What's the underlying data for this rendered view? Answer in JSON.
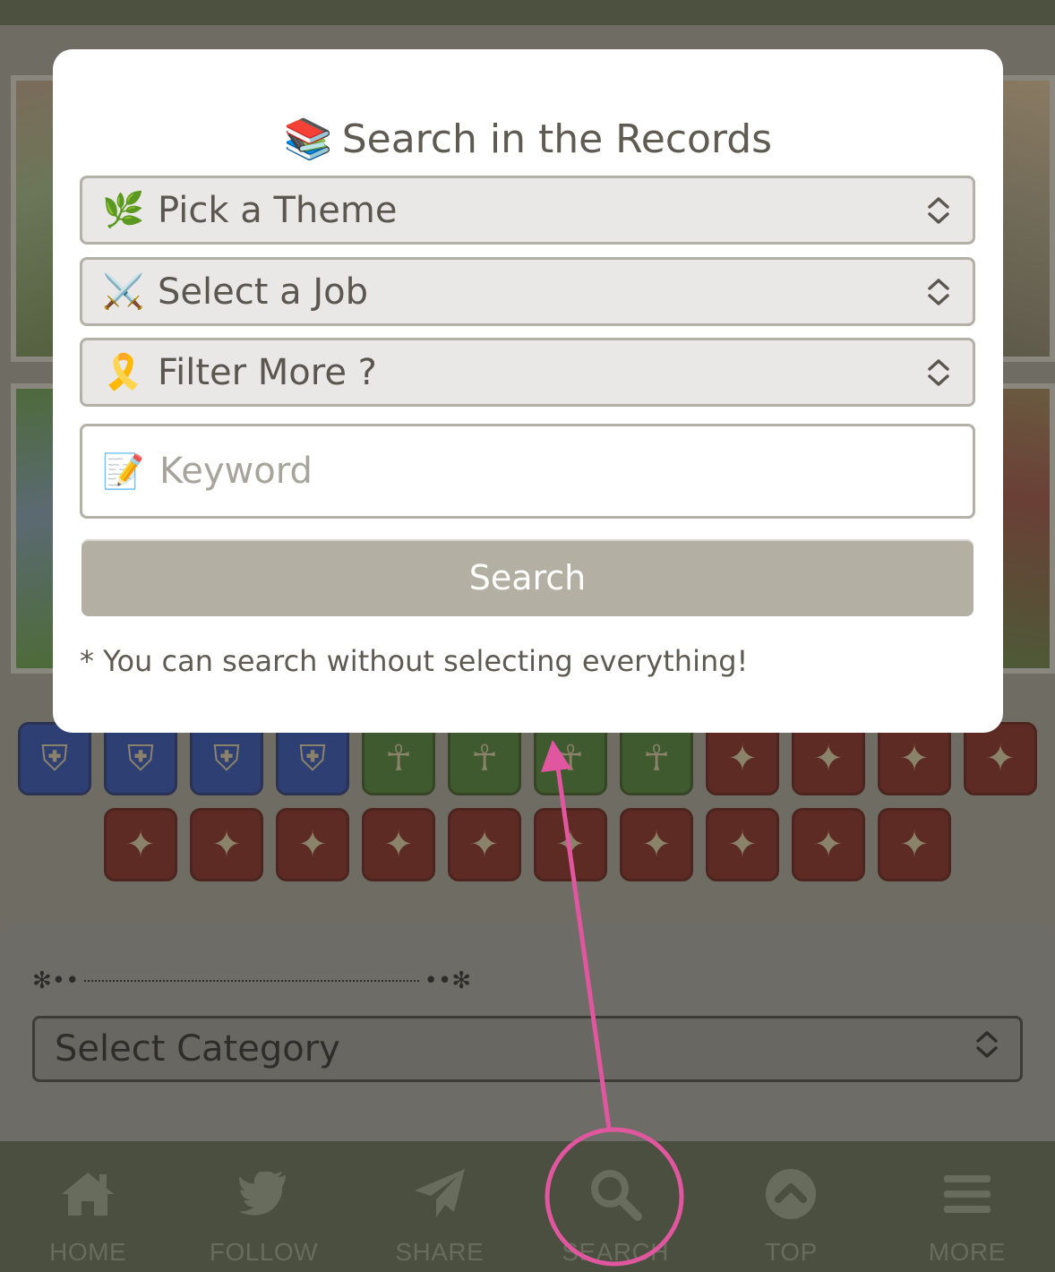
{
  "modal": {
    "title_emoji": "📚",
    "title": "Search in the Records",
    "theme_select": {
      "emoji": "🌿",
      "label": "Pick a Theme"
    },
    "job_select": {
      "emoji": "⚔️",
      "label": "Select a Job"
    },
    "filter_select": {
      "emoji": "🎗️",
      "label": "Filter More ?"
    },
    "keyword": {
      "emoji": "📝",
      "placeholder": "Keyword",
      "value": ""
    },
    "search_button": "Search",
    "note": "* You can search without selecting everything!"
  },
  "background": {
    "category_select": "Select Category",
    "job_icons_row1": [
      "tank",
      "tank",
      "tank",
      "tank",
      "heal",
      "heal",
      "heal",
      "heal",
      "dps",
      "dps",
      "dps",
      "dps"
    ],
    "job_icons_row2": [
      "dps",
      "dps",
      "dps",
      "dps",
      "dps",
      "dps",
      "dps",
      "dps",
      "dps",
      "dps"
    ]
  },
  "bottom_nav": [
    {
      "label": "HOME",
      "icon": "home-icon"
    },
    {
      "label": "FOLLOW",
      "icon": "twitter-icon"
    },
    {
      "label": "SHARE",
      "icon": "paper-plane-icon"
    },
    {
      "label": "SEARCH",
      "icon": "search-icon"
    },
    {
      "label": "TOP",
      "icon": "chevron-up-circle-icon"
    },
    {
      "label": "MORE",
      "icon": "menu-icon"
    }
  ],
  "colors": {
    "annotation": "#e0569f",
    "nav_background": "#4a4f3f",
    "search_button": "#b3afa3"
  }
}
